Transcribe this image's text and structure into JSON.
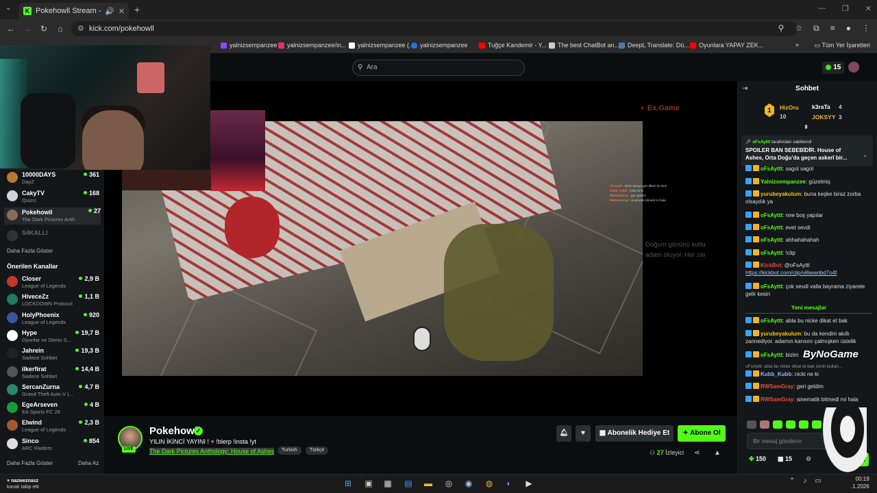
{
  "browser": {
    "tab_title": "Pokehowll Stream - Watch",
    "url": "kick.com/pokehowll",
    "bookmarks": [
      {
        "label": "yalnizsempanzee",
        "color": "#9146ff"
      },
      {
        "label": "yalnizsempanzee/in...",
        "color": "#e1306c"
      },
      {
        "label": "yalnizsempanzee (...",
        "color": "#ffffff"
      },
      {
        "label": "yalnizsempanzee",
        "color": "#1877f2"
      },
      {
        "label": "Tuğçe Kandemir - Y...",
        "color": "#ff0000"
      },
      {
        "label": "The best ChatBot an...",
        "color": "#cccccc"
      },
      {
        "label": "DeepL Translate: Dü...",
        "color": "#0f2b46"
      },
      {
        "label": "Oyunlara YAPAY ZEK...",
        "color": "#ff0000"
      }
    ],
    "all_bookmarks": "Tüm Yer İşaretleri"
  },
  "topnav": {
    "search_placeholder": "Ara",
    "kicks": "15"
  },
  "sidebar": {
    "followed": [
      {
        "name": "10000DAYS",
        "category": "DayZ",
        "viewers": "361",
        "color": "#b97a2b"
      },
      {
        "name": "CakyTV",
        "category": "Quizci",
        "viewers": "168",
        "color": "#cfd6da"
      },
      {
        "name": "Pokehowll",
        "category": "The Dark Pictures Anth...",
        "viewers": "27",
        "color": "#8a6a5a",
        "active": true
      },
      {
        "name": "S4KALLI",
        "category": "",
        "viewers": "",
        "color": "#333",
        "offline": true
      }
    ],
    "show_more": "Daha Fazla Göster",
    "recommended_title": "Önerilen Kanallar",
    "recommended": [
      {
        "name": "Closer",
        "category": "League of Legends",
        "viewers": "2,9 B",
        "color": "#c0392b"
      },
      {
        "name": "HiveceZz",
        "category": "LOCKDOWN Protocol",
        "viewers": "1,1 B",
        "color": "#1e7a5a"
      },
      {
        "name": "HolyPhoenix",
        "category": "League of Legends",
        "viewers": "920",
        "color": "#3a55a0"
      },
      {
        "name": "Hype",
        "category": "Oyunlar ve Demo S...",
        "viewers": "19,7 B",
        "color": "#ffffff"
      },
      {
        "name": "Jahrein",
        "category": "Sadece Sohbet",
        "viewers": "19,3 B",
        "color": "#222"
      },
      {
        "name": "ilkerfirat",
        "category": "Sadece Sohbet",
        "viewers": "14,4 B",
        "color": "#555"
      },
      {
        "name": "SercanZurna",
        "category": "Grand Theft Auto V (...",
        "viewers": "4,7 B",
        "color": "#2a8a6a"
      },
      {
        "name": "EgeArseven",
        "category": "EA Sports FC 26",
        "viewers": "4 B",
        "color": "#1a9a3a"
      },
      {
        "name": "Elwind",
        "category": "League of Legends",
        "viewers": "2,3 B",
        "color": "#a05a30"
      },
      {
        "name": "Sinco",
        "category": "ARC Raiders",
        "viewers": "854",
        "color": "#ddd"
      }
    ],
    "show_more2": "Daha Fazla Göster",
    "show_less": "Daha Az"
  },
  "stream": {
    "channel": "Pokehowll",
    "live_label": "LIVE",
    "title_part1": "YILIN İKİNCİ YAYINI ! ",
    "title_part2": " !blerp !insta !yt",
    "category": "The Dark Pictures Anthology: House of Ashes",
    "tags": [
      "Turkish",
      "Türkçe"
    ],
    "gift_sub": "Abonelik Hediye Et",
    "subscribe": "Abone Ol",
    "viewers": "27",
    "viewers_label": "İzleyici",
    "overlay_right_text": "Doğum gününü kutlu adam oluyor. Her zaı"
  },
  "chat": {
    "title": "Sohbet",
    "leaderboard": {
      "rank": "1",
      "first": {
        "name": "HizOru",
        "count": "10"
      },
      "second": {
        "name": "k3raTa",
        "count": "4"
      },
      "third": {
        "name": "JOKSYY",
        "count": "3"
      }
    },
    "pinned": {
      "by": "oFsAyttt",
      "by_suffix": " tarafından sabitlendi",
      "message": "SPOILER BAN SEBEBİDİR. House of Ashes, Orta Doğu'da geçen askerî bir..."
    },
    "messages": [
      {
        "user": "oFsAyttt",
        "color": "#53fc18",
        "text": "sagol sagol"
      },
      {
        "user": "Yalnizsempanzee",
        "color": "#53fc18",
        "text": "güzelmiş"
      },
      {
        "user": "yurubeyakulum",
        "color": "#f0c419",
        "text": "buna keşke biraz zorba olsaydık ya"
      },
      {
        "user": "oFsAyttt",
        "color": "#53fc18",
        "text": "nne boş yapılar"
      },
      {
        "user": "oFsAyttt",
        "color": "#53fc18",
        "text": "evet sevdi"
      },
      {
        "user": "oFsAyttt",
        "color": "#53fc18",
        "text": "ahhahahahah"
      },
      {
        "user": "oFsAyttt",
        "color": "#53fc18",
        "text": "!clip"
      },
      {
        "user": "KickBot",
        "color": "#e74c3c",
        "text": "@oFsAyttt",
        "link": "https://kickbot.com/clip/vi6wwnbd7o4f"
      },
      {
        "user": "oFsAyttt",
        "color": "#53fc18",
        "text": "çok sevdi valla bayrama ziyarete gelir kesin"
      }
    ],
    "new_messages": "Yeni mesajlar",
    "messages2": [
      {
        "user": "oFsAyttt",
        "color": "#53fc18",
        "text": "abla bu nicke dikat et bak"
      },
      {
        "user": "yurubeyakulum",
        "color": "#f0c419",
        "text": "bu da kendini akıllı zannediyor. adamın karısını çalmışken üstelik"
      },
      {
        "user": "oFsAyttt",
        "color": "#53fc18",
        "text": "bizim"
      },
      {
        "reply": "oFsAyttt: abla bu nicke dikat et bak isimli kullan..."
      },
      {
        "user": "Kubb_Kubb",
        "color": "#8fb8ff",
        "text": "nicki ne ki"
      },
      {
        "user": "RWSamGray",
        "color": "#e74c3c",
        "text": "geri geldim"
      },
      {
        "user": "RWSamGray",
        "color": "#e74c3c",
        "text": "sinematik bitmedi mi hala"
      }
    ],
    "watermark": "ByNoGame",
    "input_placeholder": "Bir mesaj gönderin",
    "points": "150",
    "gifts": "15",
    "send": "der"
  },
  "taskbar": {
    "follow_user": "nazweznasz",
    "follow_text": "kanalı takip etti",
    "time": "00:19",
    "date": ".1.2026"
  }
}
